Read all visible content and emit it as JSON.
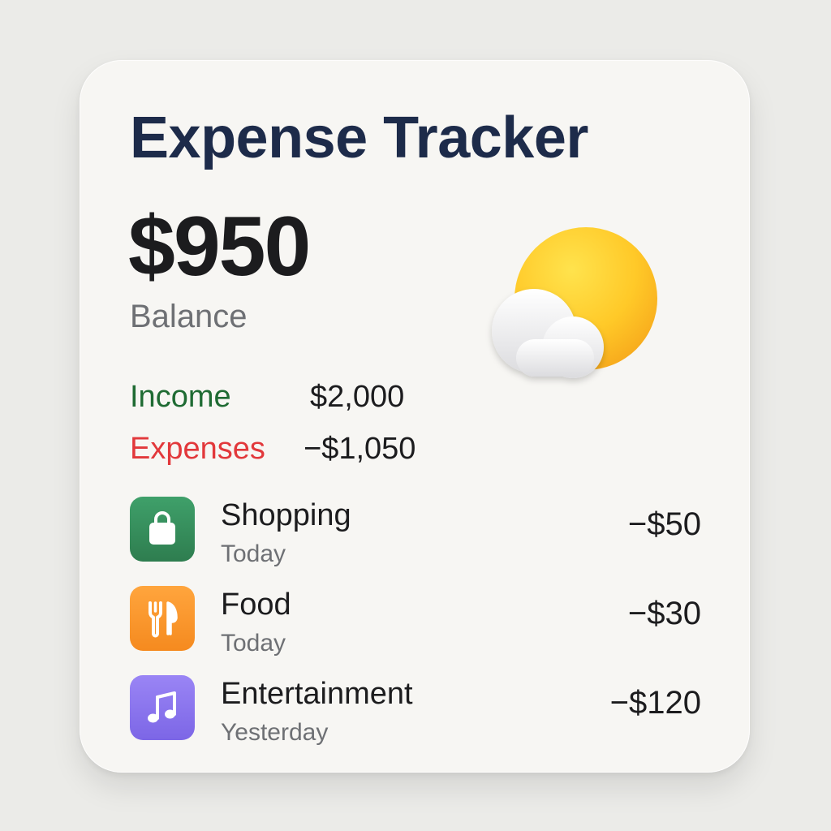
{
  "widget": {
    "title": "Expense Tracker",
    "balance": {
      "amount": "$950",
      "label": "Balance"
    },
    "income": {
      "label": "Income",
      "value": "$2,000"
    },
    "expenses": {
      "label": "Expenses",
      "value": "−$1,050"
    },
    "weather_icon": "sun-behind-cloud-icon",
    "transactions": [
      {
        "name": "Shopping",
        "when": "Today",
        "amount": "−$50",
        "icon": "shopping-bag-icon",
        "color": "#2e7d4f"
      },
      {
        "name": "Food",
        "when": "Today",
        "amount": "−$30",
        "icon": "fork-knife-icon",
        "color": "#f58a1f"
      },
      {
        "name": "Entertainment",
        "when": "Yesterday",
        "amount": "−$120",
        "icon": "music-note-icon",
        "color": "#7c66e6"
      }
    ]
  },
  "colors": {
    "title": "#1d2b4a",
    "income": "#1f6b33",
    "expenses": "#e2383b",
    "card": "#f7f6f3",
    "background": "#ebebe8"
  }
}
